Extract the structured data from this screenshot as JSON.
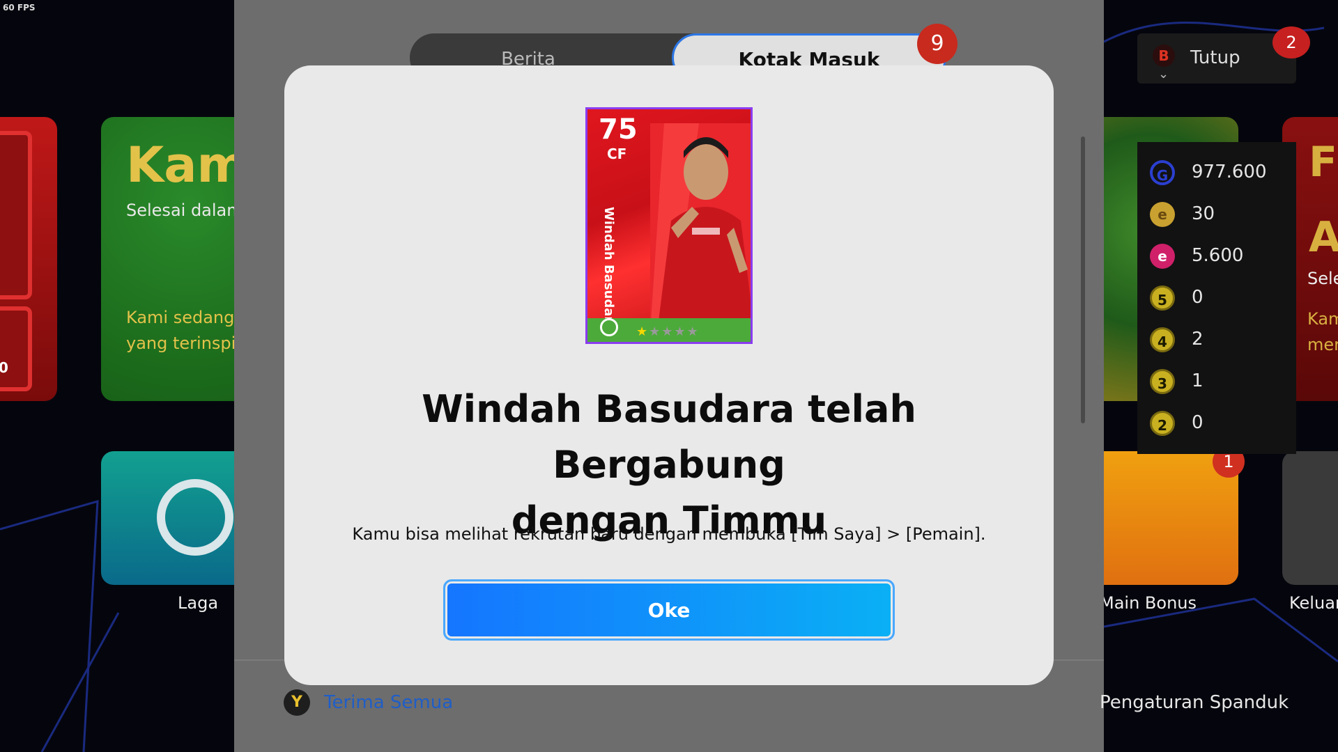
{
  "overlay": {
    "fps": "60 FPS"
  },
  "background": {
    "tile_left_red": {
      "number": "0"
    },
    "tile_green": {
      "title": "Kamp",
      "subtitle": "Selesai dalam",
      "body_line1": "Kami sedang",
      "body_line2": "yang terinspi"
    },
    "tile_laga": {
      "label": "Laga"
    },
    "tile_right_red": {
      "title_line1": "F",
      "title_line2": "A",
      "subtitle": "Sele",
      "body_line1": "Kam",
      "body_line2": "mer"
    },
    "tile_main_bonus": {
      "label": "Main Bonus",
      "badge": "1"
    },
    "tile_keluar": {
      "label": "Keluar"
    },
    "tutup": {
      "key_icon": "B",
      "label": "Tutup",
      "badge": "2"
    },
    "currencies": [
      {
        "icon": "G",
        "value": "977.600",
        "color": "#2b3fd0"
      },
      {
        "icon": "e",
        "value": "30",
        "color": "#c9a130"
      },
      {
        "icon": "e",
        "value": "5.600",
        "color": "#d0206a"
      },
      {
        "icon": "5",
        "value": "0",
        "color": "#c9b020"
      },
      {
        "icon": "4",
        "value": "2",
        "color": "#c9b020"
      },
      {
        "icon": "3",
        "value": "1",
        "color": "#c9b020"
      },
      {
        "icon": "2",
        "value": "0",
        "color": "#c9b020"
      }
    ]
  },
  "inbox": {
    "tabs": [
      {
        "label": "Berita",
        "active": false
      },
      {
        "label": "Kotak Masuk",
        "active": true,
        "badge": "9"
      }
    ],
    "footer": {
      "accept_all_key": "Y",
      "accept_all_label": "Terima Semua",
      "banner_settings_label": "Pengaturan Spanduk"
    }
  },
  "modal": {
    "card": {
      "rating": "75",
      "position": "CF",
      "player_name": "Windah Basudara",
      "stars_filled": 1,
      "stars_total": 5
    },
    "title_line1": "Windah Basudara telah Bergabung",
    "title_line2": "dengan Timmu",
    "subtitle": "Kamu bisa melihat rekrutan baru dengan membuka [Tim Saya] > [Pemain].",
    "ok_label": "Oke"
  },
  "colors": {
    "accent_blue": "#1575ff",
    "badge_red": "#c82a1e",
    "modal_bg": "#e9e9e9"
  }
}
